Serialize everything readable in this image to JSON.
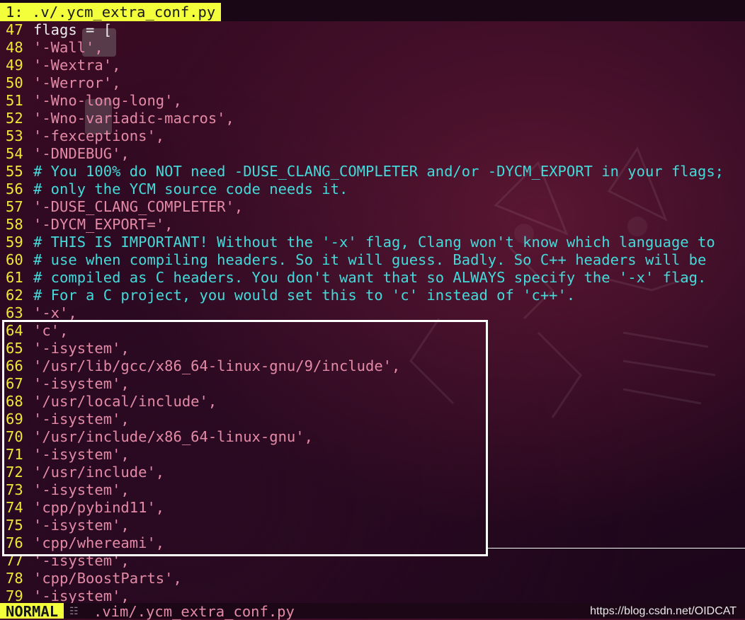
{
  "tabline": {
    "active_tab": "1: .v/.ycm_extra_conf.py"
  },
  "lines": [
    {
      "n": "47",
      "text": "flags = [",
      "kind": "plain"
    },
    {
      "n": "48",
      "text": "'-Wall',",
      "kind": "str"
    },
    {
      "n": "49",
      "text": "'-Wextra',",
      "kind": "str"
    },
    {
      "n": "50",
      "text": "'-Werror',",
      "kind": "str"
    },
    {
      "n": "51",
      "text": "'-Wno-long-long',",
      "kind": "str"
    },
    {
      "n": "52",
      "text": "'-Wno-variadic-macros',",
      "kind": "str"
    },
    {
      "n": "53",
      "text": "'-fexceptions',",
      "kind": "str"
    },
    {
      "n": "54",
      "text": "'-DNDEBUG',",
      "kind": "str"
    },
    {
      "n": "55",
      "text": "# You 100% do NOT need -DUSE_CLANG_COMPLETER and/or -DYCM_EXPORT in your flags;",
      "kind": "cmt"
    },
    {
      "n": "56",
      "text": "# only the YCM source code needs it.",
      "kind": "cmt"
    },
    {
      "n": "57",
      "text": "'-DUSE_CLANG_COMPLETER',",
      "kind": "str"
    },
    {
      "n": "58",
      "text": "'-DYCM_EXPORT=',",
      "kind": "str"
    },
    {
      "n": "59",
      "text": "# THIS IS IMPORTANT! Without the '-x' flag, Clang won't know which language to",
      "kind": "cmt"
    },
    {
      "n": "60",
      "text": "# use when compiling headers. So it will guess. Badly. So C++ headers will be",
      "kind": "cmt"
    },
    {
      "n": "61",
      "text": "# compiled as C headers. You don't want that so ALWAYS specify the '-x' flag.",
      "kind": "cmt"
    },
    {
      "n": "62",
      "text": "# For a C project, you would set this to 'c' instead of 'c++'.",
      "kind": "cmt"
    },
    {
      "n": "63",
      "text": "'-x',",
      "kind": "str"
    },
    {
      "n": "64",
      "text": "'c',",
      "kind": "str"
    },
    {
      "n": "65",
      "text": "'-isystem',",
      "kind": "str"
    },
    {
      "n": "66",
      "text": "'/usr/lib/gcc/x86_64-linux-gnu/9/include',",
      "kind": "str"
    },
    {
      "n": "67",
      "text": "'-isystem',",
      "kind": "str"
    },
    {
      "n": "68",
      "text": "'/usr/local/include',",
      "kind": "str"
    },
    {
      "n": "69",
      "text": "'-isystem',",
      "kind": "str"
    },
    {
      "n": "70",
      "text": "'/usr/include/x86_64-linux-gnu',",
      "kind": "str"
    },
    {
      "n": "71",
      "text": "'-isystem',",
      "kind": "str"
    },
    {
      "n": "72",
      "text": "'/usr/include',",
      "kind": "str"
    },
    {
      "n": "73",
      "text": "'-isystem',",
      "kind": "str"
    },
    {
      "n": "74",
      "text": "'cpp/pybind11',",
      "kind": "str"
    },
    {
      "n": "75",
      "text": "'-isystem',",
      "kind": "str"
    },
    {
      "n": "76",
      "text": "'cpp/whereami',",
      "kind": "str"
    },
    {
      "n": "77",
      "text": "'-isystem',",
      "kind": "str"
    },
    {
      "n": "78",
      "text": "'cpp/BoostParts',",
      "kind": "str"
    },
    {
      "n": "79",
      "text": "'-isystem',",
      "kind": "str"
    }
  ],
  "statusline": {
    "mode": "NORMAL",
    "branch_icon": "git-branch-icon",
    "file": ".vim/.ycm_extra_conf.py",
    "watermark": "https://blog.csdn.net/OIDCAT"
  },
  "colors": {
    "tab_accent": "#f2ff3a",
    "line_number": "#f0e63a",
    "string": "#e48aa6",
    "comment": "#44dada",
    "highlight_box": "#ffffff"
  }
}
